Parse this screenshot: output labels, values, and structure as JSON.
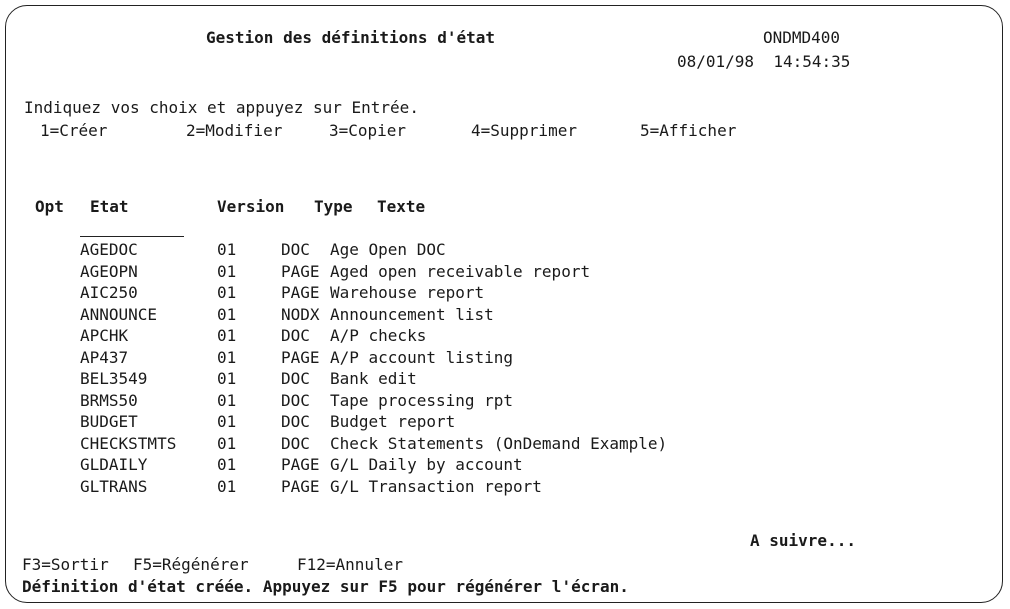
{
  "screen": {
    "title": "Gestion des définitions d'état",
    "system_name": "ONDMD400",
    "date": "08/01/98",
    "time": "14:54:35",
    "instructions": "Indiquez vos choix et appuyez sur Entrée.",
    "options": [
      {
        "label": "1=Créer"
      },
      {
        "label": "2=Modifier"
      },
      {
        "label": "3=Copier"
      },
      {
        "label": "4=Supprimer"
      },
      {
        "label": "5=Afficher"
      }
    ],
    "columns": {
      "opt": "Opt",
      "name": "Etat",
      "version": "Version",
      "type": "Type",
      "text": "Texte"
    },
    "rows": [
      {
        "name": "AGEDOC",
        "version": "01",
        "type": "DOC",
        "text": "Age Open DOC"
      },
      {
        "name": "AGEOPN",
        "version": "01",
        "type": "PAGE",
        "text": "Aged open receivable report"
      },
      {
        "name": "AIC250",
        "version": "01",
        "type": "PAGE",
        "text": "Warehouse report"
      },
      {
        "name": "ANNOUNCE",
        "version": "01",
        "type": "NODX",
        "text": "Announcement list"
      },
      {
        "name": "APCHK",
        "version": "01",
        "type": "DOC",
        "text": "A/P checks"
      },
      {
        "name": "AP437",
        "version": "01",
        "type": "PAGE",
        "text": "A/P account listing"
      },
      {
        "name": "BEL3549",
        "version": "01",
        "type": "DOC",
        "text": "Bank edit"
      },
      {
        "name": "BRMS50",
        "version": "01",
        "type": "DOC",
        "text": "Tape processing rpt"
      },
      {
        "name": "BUDGET",
        "version": "01",
        "type": "DOC",
        "text": "Budget report"
      },
      {
        "name": "CHECKSTMTS",
        "version": "01",
        "type": "DOC",
        "text": "Check Statements (OnDemand Example)"
      },
      {
        "name": "GLDAILY",
        "version": "01",
        "type": "PAGE",
        "text": "G/L Daily by account"
      },
      {
        "name": "GLTRANS",
        "version": "01",
        "type": "PAGE",
        "text": "G/L Transaction report"
      }
    ],
    "more_indicator": "A suivre...",
    "function_keys": [
      {
        "label": "F3=Sortir"
      },
      {
        "label": "F5=Régénérer"
      },
      {
        "label": "F12=Annuler"
      }
    ],
    "message": "Définition d'état créée. Appuyez sur F5 pour régénérer l'écran."
  }
}
